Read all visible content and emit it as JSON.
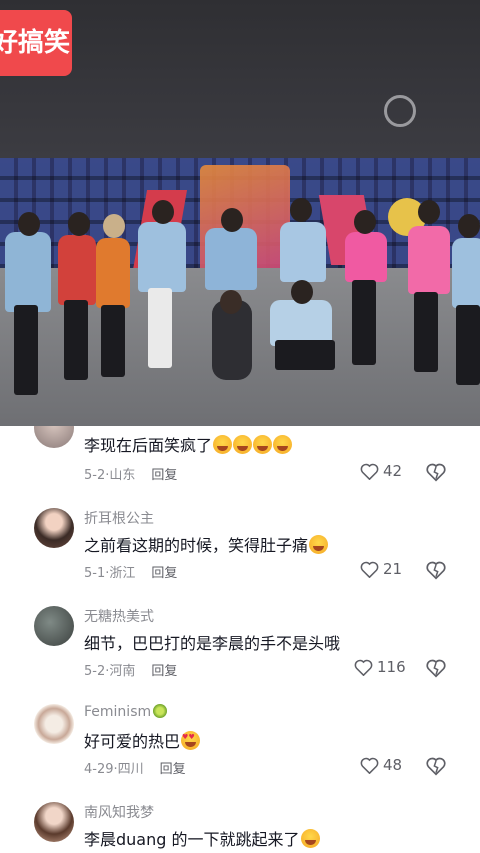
{
  "video": {
    "watermark_text": "好搞笑"
  },
  "comments": [
    {
      "username": "",
      "text": "李现在后面笑疯了",
      "emoji": [
        "laugh-cry",
        "laugh-cry",
        "laugh-cry",
        "laugh-cry"
      ],
      "date": "5-2",
      "location": "山东",
      "reply_label": "回复",
      "likes": "42"
    },
    {
      "username": "折耳根公主",
      "text": "之前看这期的时候，笑得肚子痛",
      "emoji": [
        "laugh-cry"
      ],
      "date": "5-1",
      "location": "浙江",
      "reply_label": "回复",
      "likes": "21"
    },
    {
      "username": "无糖热美式",
      "text": "细节，巴巴打的是李晨的手不是头哦",
      "emoji": [],
      "date": "5-2",
      "location": "河南",
      "reply_label": "回复",
      "likes": "116"
    },
    {
      "username": "Feminism",
      "username_emoji": "kiwi",
      "text": "好可爱的热巴",
      "emoji": [
        "heart-eyes"
      ],
      "date": "4-29",
      "location": "四川",
      "reply_label": "回复",
      "likes": "48"
    },
    {
      "username": "南风知我梦",
      "text": "李晨duang 的一下就跳起来了",
      "emoji": [
        "laugh-cry"
      ],
      "date": "",
      "location": "",
      "reply_label": "",
      "likes": ""
    }
  ],
  "colors": {
    "watermark_bg": "#f0494c",
    "text_primary": "#161823",
    "text_secondary": "#8a8b91"
  }
}
